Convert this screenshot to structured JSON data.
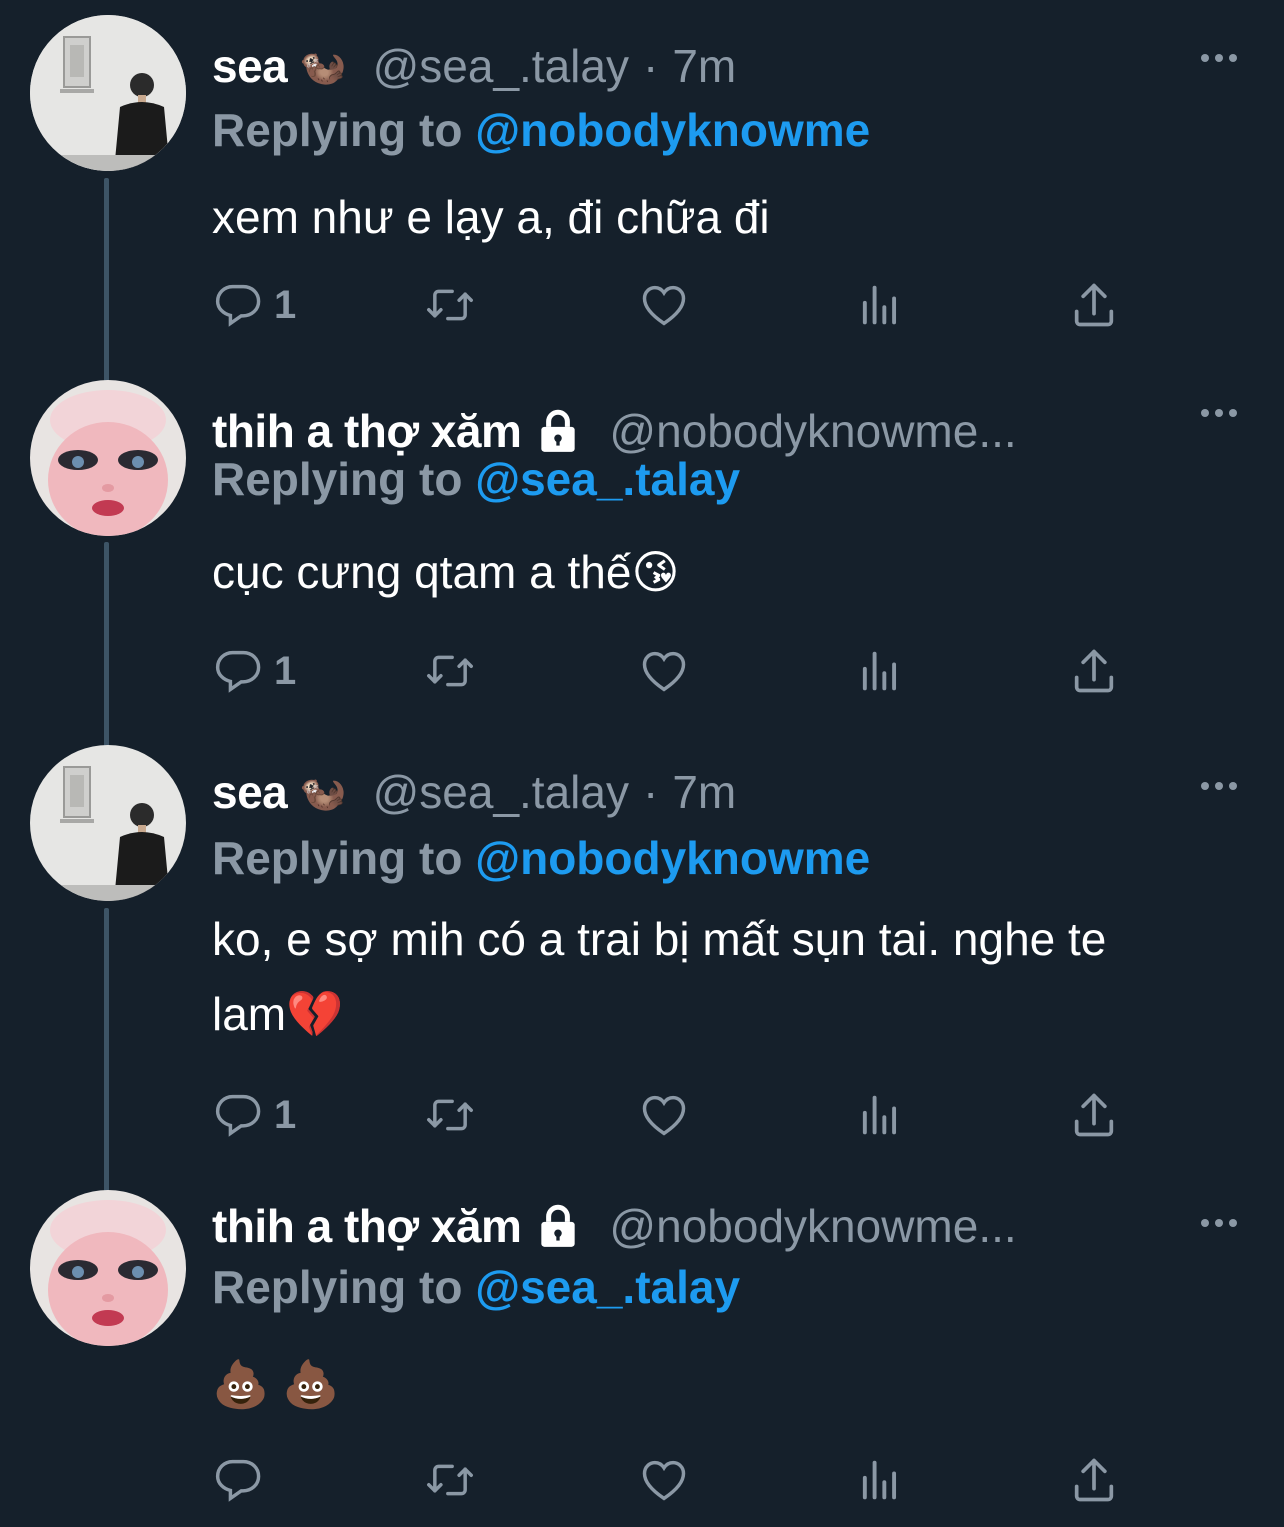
{
  "tweets": [
    {
      "display_name": "sea",
      "name_emoji": "🦦",
      "locked": false,
      "handle": "@sea_.talay",
      "separator": "·",
      "time": "7m",
      "replying_label": "Replying to",
      "replying_to": "@nobodyknowme",
      "body": "xem như e lạy a, đi chữa đi",
      "reply_count": "1",
      "avatar": "man-in-black-sweater-photo"
    },
    {
      "display_name": "thih a thợ xăm",
      "name_emoji": "",
      "locked": true,
      "handle": "@nobodyknowme...",
      "separator": "",
      "time": "",
      "replying_label": "Replying to",
      "replying_to": "@sea_.talay",
      "body": "cục cưng qtam a thế😘",
      "reply_count": "1",
      "avatar": "doll-face-photo"
    },
    {
      "display_name": "sea",
      "name_emoji": "🦦",
      "locked": false,
      "handle": "@sea_.talay",
      "separator": "·",
      "time": "7m",
      "replying_label": "Replying to",
      "replying_to": "@nobodyknowme",
      "body": "ko, e sợ mih có a trai bị mất sụn tai. nghe te lam💔",
      "reply_count": "1",
      "avatar": "man-in-black-sweater-photo"
    },
    {
      "display_name": "thih a thợ xăm",
      "name_emoji": "",
      "locked": true,
      "handle": "@nobodyknowme...",
      "separator": "",
      "time": "",
      "replying_label": "Replying to",
      "replying_to": "@sea_.talay",
      "body": "💩 💩",
      "reply_count": "",
      "avatar": "doll-face-photo"
    }
  ],
  "icons": {
    "reply": "reply-icon",
    "retweet": "retweet-icon",
    "like": "like-icon",
    "views": "views-icon",
    "share": "share-icon",
    "more": "more-icon",
    "lock": "lock-icon"
  },
  "colors": {
    "background": "#15202b",
    "text": "#ffffff",
    "secondary": "#8b98a5",
    "mention": "#1d9bf0",
    "thread_line": "#3d5466"
  }
}
